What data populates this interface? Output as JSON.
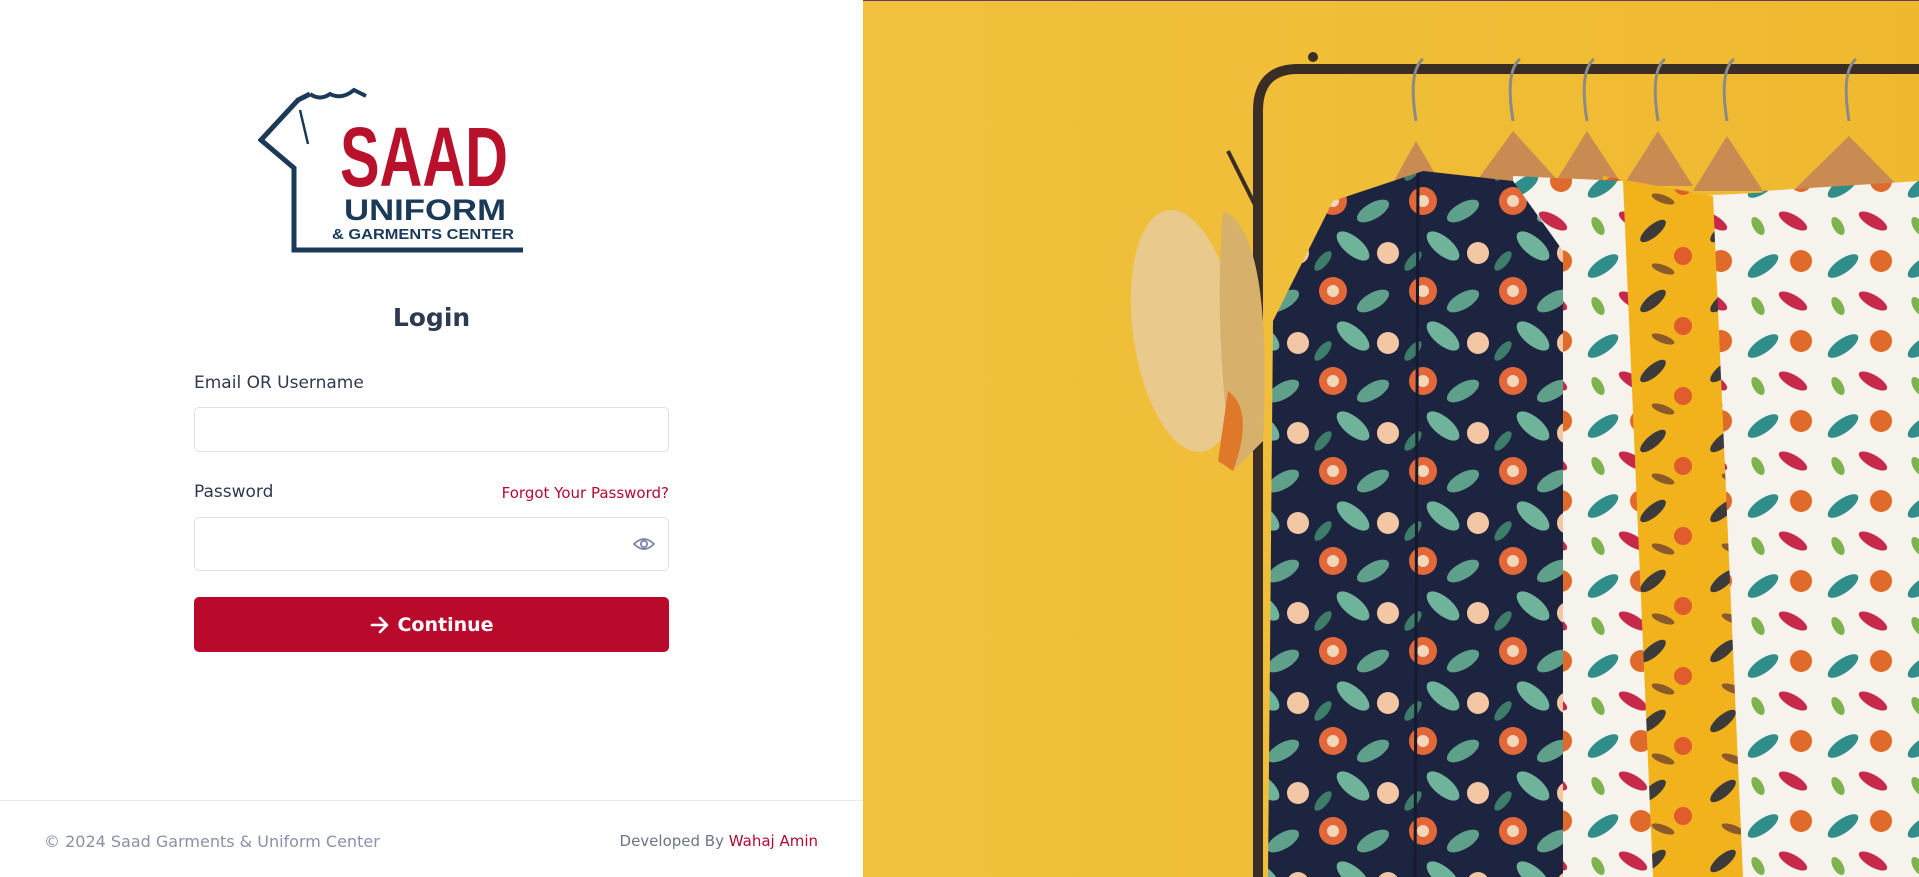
{
  "logo": {
    "brand": "SAAD",
    "line1": "UNIFORM",
    "line2": "& GARMENTS CENTER",
    "icon": "tshirt-icon",
    "colors": {
      "red": "#b9102b",
      "navy": "#1b3a58"
    }
  },
  "login": {
    "title": "Login",
    "email_label": "Email OR Username",
    "email_value": "",
    "password_label": "Password",
    "password_value": "",
    "forgot_label": "Forgot Your Password?",
    "continue_label": "Continue",
    "continue_icon": "arrow-right-icon",
    "eye_icon": "eye-icon"
  },
  "footer": {
    "copyright": "© 2024 Saad Garments & Uniform Center",
    "developed_by": "Developed By",
    "developer": "Wahaj Amin"
  },
  "colors": {
    "accent": "#ba0a2b",
    "background_right": "#f0bd37"
  }
}
